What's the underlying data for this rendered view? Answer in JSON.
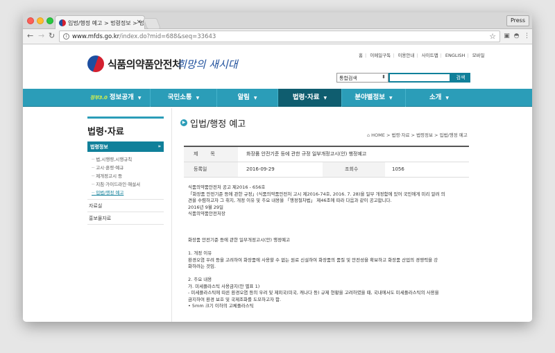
{
  "browser": {
    "tab_title": "입법/행정 예고 > 법령정보 > 법령·자",
    "tab_close": "×",
    "press_button": "Press",
    "url_host": "www.mfds.go.kr",
    "url_path": "/index.do?mid=688&seq=33643"
  },
  "header": {
    "util_links": [
      "홈",
      "이메일구독",
      "이용안내",
      "사이트맵",
      "ENGLISH",
      "모바일"
    ],
    "logo_text": "식품의약품안전처",
    "slogan": "희망의 새시대",
    "search_select": "통합검색",
    "search_button": "검색"
  },
  "gnb": {
    "brand_tag": "정부3.0",
    "items": [
      {
        "label": "정보공개",
        "has_menu": true
      },
      {
        "label": "국민소통",
        "has_menu": true
      },
      {
        "label": "알림",
        "has_menu": true
      },
      {
        "label": "법령·자료",
        "has_menu": true,
        "active": true
      },
      {
        "label": "분야별정보",
        "has_menu": true
      },
      {
        "label": "소개",
        "has_menu": true
      }
    ]
  },
  "lnb": {
    "title": "법령·자료",
    "active_section": "법령정보",
    "active_arrow": "»",
    "sub_items": [
      "법,시행령,시행규칙",
      "고시·훈령·예규",
      "제개정고시 등",
      "지침·가이드라인·해설서",
      "입법/행정 예고"
    ],
    "current_index": 4,
    "other_items": [
      "자료실",
      "홍보물자료"
    ]
  },
  "page": {
    "title": "입법/행정 예고",
    "breadcrumb": [
      "HOME",
      "법령·자료",
      "법령정보",
      "입법/행정 예고"
    ]
  },
  "post": {
    "subject_label": "제        목",
    "subject": "화장품 안전기준 등에 관한 규정 일부개정고시(안) 행정예고",
    "date_label": "등록일",
    "date": "2016-09-29",
    "views_label": "조회수",
    "views": "1056"
  },
  "body_lines": [
    "식품의약품안전처 공고 제2016 - 656호",
    "「화장품 안전기준 등에 관한 규정」(식품의약품안전처 고시 제2016-74호, 2016. 7. 28)을 일부 개정함에 있어 국민에게 미리 알려 의",
    "견을 수렴하고자 그 취지, 개정 이유 및 주요 내용을 「행정절차법」 제46조에 따라 다음과 같이 공고합니다.",
    "2016년 9월 29일",
    "식품의약품안전처장",
    "",
    "",
    "",
    "화장품 안전기준 등에 관한 일부개정고시(안) 행정예고",
    "",
    "1. 개정 이유",
    "환경오염 우려 등을 고려하여 화장품에 사용할 수 없는 원료 신설하여 화장품의 품질 및 안전성을 확보하고 화장품 산업의 경쟁력을 강",
    "화하려는 것임.",
    "",
    "2. 주요 내용",
    "가. 미세플라스틱 사용금지(안 별표 1)",
    "- 미세플라스틱에 따른 환경오염 등의 우려 및 제외국(미국, 캐나다 등) 규제 현황을 고려하였을 때, 국내에서도 미세플라스틱의 사용을",
    "금지하여 환경 보호 및 국제조화를 도모하고자 함.",
    "• 5mm 크기 이하의 고체플라스틱"
  ]
}
